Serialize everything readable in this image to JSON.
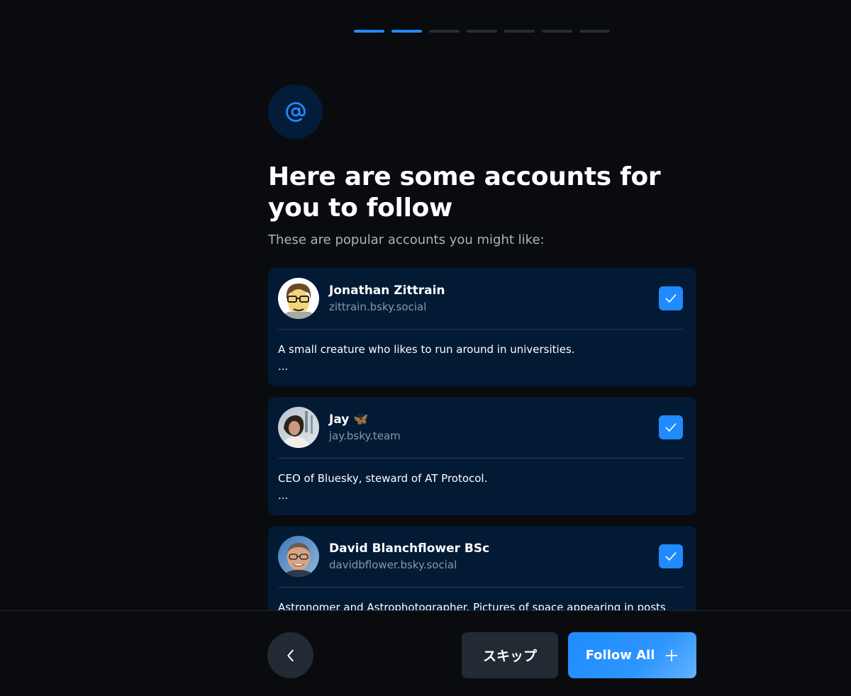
{
  "onboarding": {
    "progress_steps": 7,
    "progress_current": 2,
    "title": "Here are some accounts for you to follow",
    "subtitle": "These are popular accounts you might like:"
  },
  "accounts": [
    {
      "name": "Jonathan Zittrain",
      "handle": "zittrain.bsky.social",
      "bio": "A small creature who likes to run around in universities.",
      "more": "...",
      "selected": true,
      "avatar": "cartoon-avatar"
    },
    {
      "name": "Jay 🦋",
      "handle": "jay.bsky.team",
      "bio": "CEO of Bluesky, steward of AT Protocol.",
      "more": "...",
      "selected": true,
      "avatar": "photo-avatar"
    },
    {
      "name": "David Blanchflower BSc",
      "handle": "davidbflower.bsky.social",
      "bio": "Astronomer and Astrophotographer. Pictures of space appearing in posts",
      "more": "",
      "selected": true,
      "avatar": "photo-avatar"
    }
  ],
  "footer": {
    "back_icon": "chevron-left-icon",
    "skip_label": "スキップ",
    "follow_all_label": "Follow All",
    "follow_all_icon": "plus-icon"
  },
  "colors": {
    "background": "#0a0b0e",
    "accent": "#208bfe",
    "card": "#031a35",
    "icon_circle": "#031c3a",
    "secondary_button": "#222a33",
    "muted_text": "#8a97a8"
  }
}
